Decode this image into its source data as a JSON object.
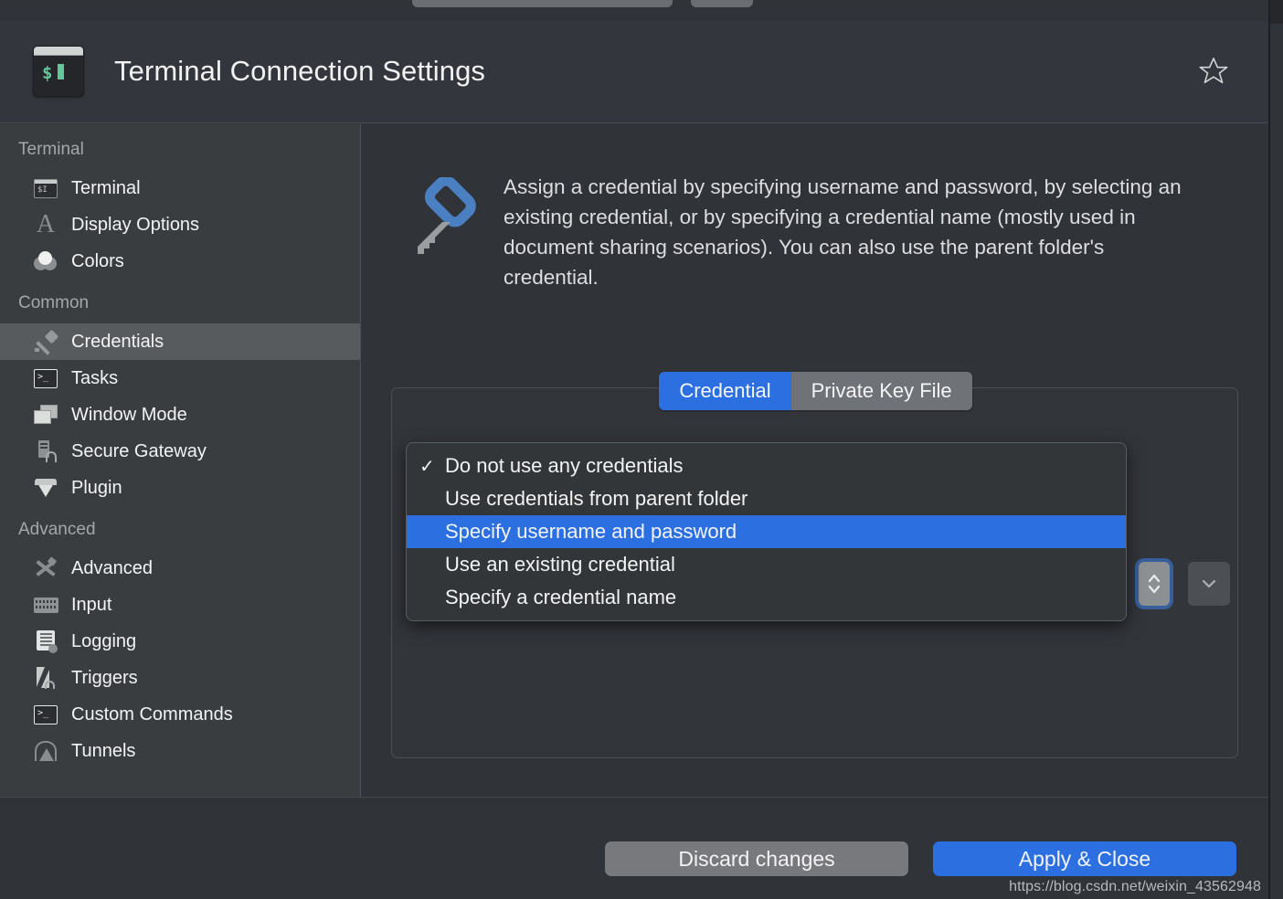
{
  "header": {
    "title": "Terminal Connection Settings",
    "app_icon": "terminal-icon",
    "icon_prompt": "$",
    "favorite_icon": "star-outline-icon"
  },
  "sidebar": {
    "groups": [
      {
        "label": "Terminal",
        "items": [
          {
            "label": "Terminal",
            "icon": "terminal-icon",
            "selected": false
          },
          {
            "label": "Display Options",
            "icon": "font-letter-a-icon",
            "selected": false
          },
          {
            "label": "Colors",
            "icon": "color-circles-icon",
            "selected": false
          }
        ]
      },
      {
        "label": "Common",
        "items": [
          {
            "label": "Credentials",
            "icon": "key-icon",
            "selected": true
          },
          {
            "label": "Tasks",
            "icon": "command-prompt-icon",
            "selected": false
          },
          {
            "label": "Window Mode",
            "icon": "windows-stack-icon",
            "selected": false
          },
          {
            "label": "Secure Gateway",
            "icon": "server-tunnel-icon",
            "selected": false
          },
          {
            "label": "Plugin",
            "icon": "plugin-box-icon",
            "selected": false
          }
        ]
      },
      {
        "label": "Advanced",
        "items": [
          {
            "label": "Advanced",
            "icon": "tools-icon",
            "selected": false
          },
          {
            "label": "Input",
            "icon": "keyboard-icon",
            "selected": false
          },
          {
            "label": "Logging",
            "icon": "notebook-log-icon",
            "selected": false
          },
          {
            "label": "Triggers",
            "icon": "lightning-bolt-icon",
            "selected": false
          },
          {
            "label": "Custom Commands",
            "icon": "command-play-icon",
            "selected": false
          },
          {
            "label": "Tunnels",
            "icon": "tunnel-arch-icon",
            "selected": false
          }
        ]
      }
    ]
  },
  "main": {
    "description_icon": "key-icon",
    "description": "Assign a credential by specifying username and password, by selecting an existing credential, or by specifying a credential name (mostly used in document sharing scenarios). You can also use the parent folder's credential.",
    "tabs": [
      {
        "label": "Credential",
        "active": true
      },
      {
        "label": "Private Key File",
        "active": false
      }
    ],
    "stepper_icon": "stepper-up-down-icon",
    "dropdown_button_icon": "chevron-down-icon"
  },
  "dropdown_menu": {
    "checked_index": 0,
    "highlighted_index": 2,
    "check_glyph": "✓",
    "options": [
      "Do not use any credentials",
      "Use credentials from parent folder",
      "Specify username and password",
      "Use an existing credential",
      "Specify a credential name"
    ]
  },
  "footer": {
    "discard_label": "Discard changes",
    "apply_label": "Apply & Close",
    "watermark": "https://blog.csdn.net/weixin_43562948"
  },
  "colors": {
    "accent_blue": "#2b6fe0",
    "window_bg": "#303338",
    "sidebar_bg": "#3a3d40",
    "header_bg": "#33363c",
    "selected_row": "#585b5e",
    "text_primary": "#f3f3f4",
    "text_muted": "#a4a7aa",
    "key_icon_blue": "#4a7fc1",
    "key_icon_gray": "#9b9e9f",
    "terminal_green": "#63c79b"
  }
}
